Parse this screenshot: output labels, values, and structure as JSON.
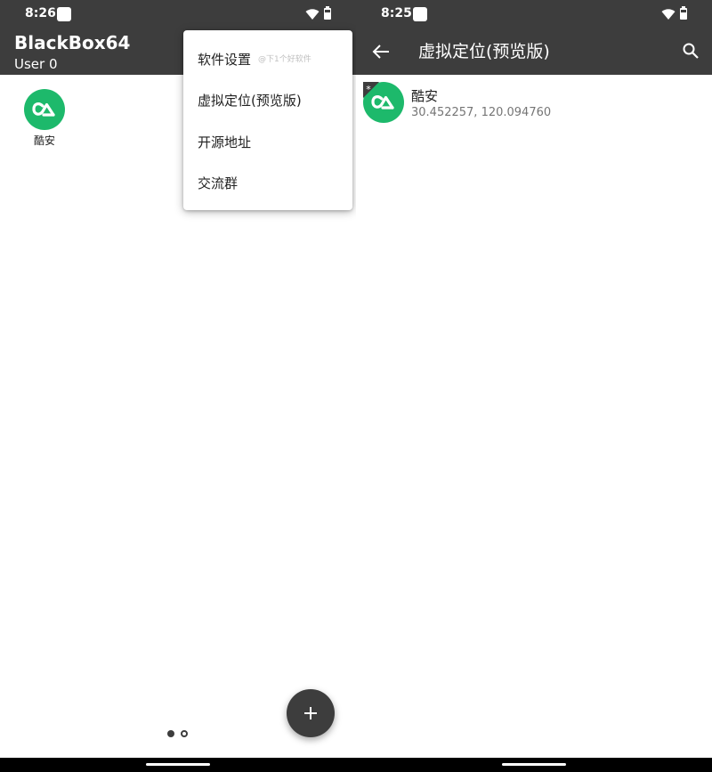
{
  "colors": {
    "toolbar": "#3d3d3d",
    "app_icon": "#1db96b",
    "navbar": "#000000"
  },
  "left": {
    "status": {
      "time": "8:26"
    },
    "appbar": {
      "title": "BlackBox64",
      "subtitle": "User 0"
    },
    "apps": [
      {
        "name": "酷安",
        "icon": "coolapk-icon"
      }
    ],
    "menu": {
      "items": [
        {
          "label": "软件设置"
        },
        {
          "label": "虚拟定位(预览版)"
        },
        {
          "label": "开源地址"
        },
        {
          "label": "交流群"
        }
      ],
      "watermark": "@下1个好软件"
    },
    "pager": {
      "pages": 2,
      "current": 1
    },
    "fab": {
      "icon": "plus-icon"
    }
  },
  "right": {
    "status": {
      "time": "8:25"
    },
    "appbar": {
      "title": "虚拟定位(预览版)"
    },
    "list": [
      {
        "name": "酷安",
        "coords": "30.452257, 120.094760",
        "badge": "*"
      }
    ]
  }
}
